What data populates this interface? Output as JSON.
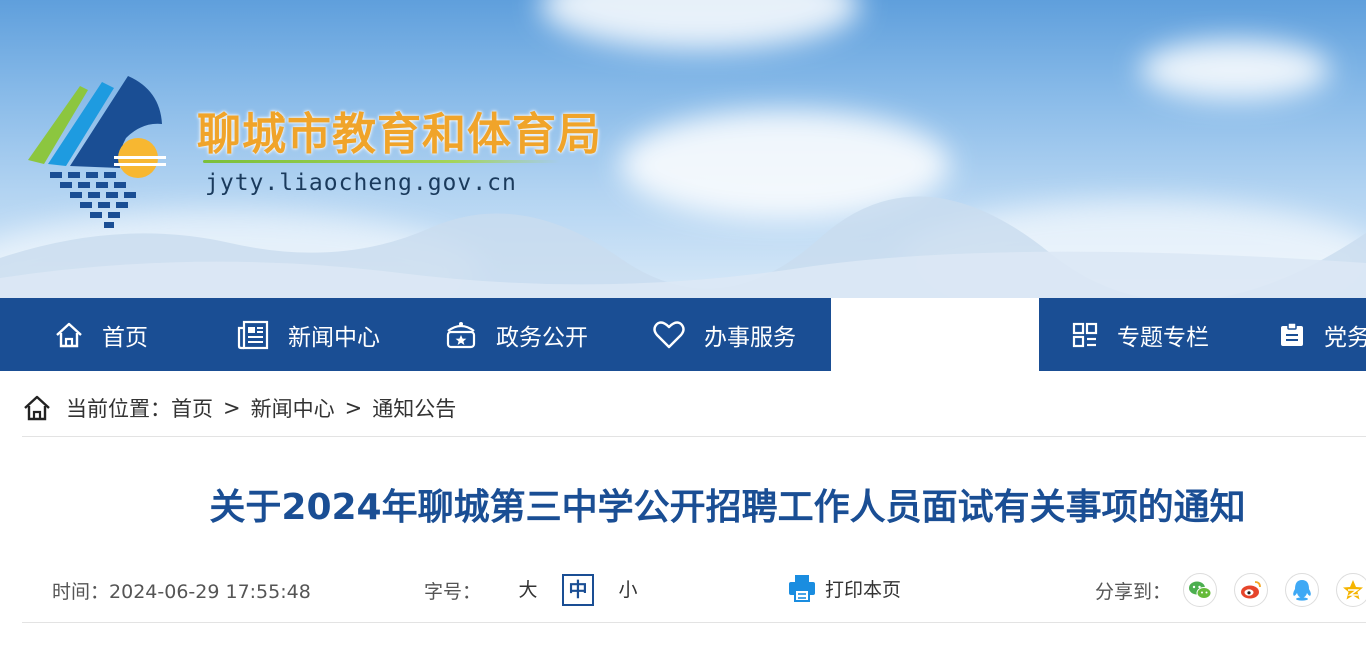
{
  "site": {
    "title": "聊城市教育和体育局",
    "domain": "jyty.liaocheng.gov.cn"
  },
  "nav": {
    "items": [
      {
        "label": "首页",
        "icon": "home-icon"
      },
      {
        "label": "新闻中心",
        "icon": "newspaper-icon"
      },
      {
        "label": "政务公开",
        "icon": "government-icon"
      },
      {
        "label": "办事服务",
        "icon": "heart-icon"
      },
      {
        "label": "",
        "icon": ""
      },
      {
        "label": "专题专栏",
        "icon": "grid-icon"
      },
      {
        "label": "党务",
        "icon": "badge-icon"
      }
    ]
  },
  "breadcrumb": {
    "prefix": "当前位置：",
    "items": [
      "首页",
      "新闻中心",
      "通知公告"
    ],
    "separator": ">"
  },
  "article": {
    "title": "关于2024年聊城第三中学公开招聘工作人员面试有关事项的通知",
    "time_label": "时间：",
    "time_value": "2024-06-29 17:55:48",
    "font_size_label": "字号：",
    "font_sizes": [
      "大",
      "中",
      "小"
    ],
    "font_size_selected": "中",
    "print_label": "打印本页",
    "share_label": "分享到："
  },
  "share_icons": [
    "wechat-icon",
    "weibo-icon",
    "qq-icon",
    "qzone-icon"
  ],
  "colors": {
    "nav_bg": "#1a4e94",
    "title_blue": "#1a4e94",
    "site_title_orange": "#f0a42a",
    "print_icon": "#1a8de0"
  }
}
